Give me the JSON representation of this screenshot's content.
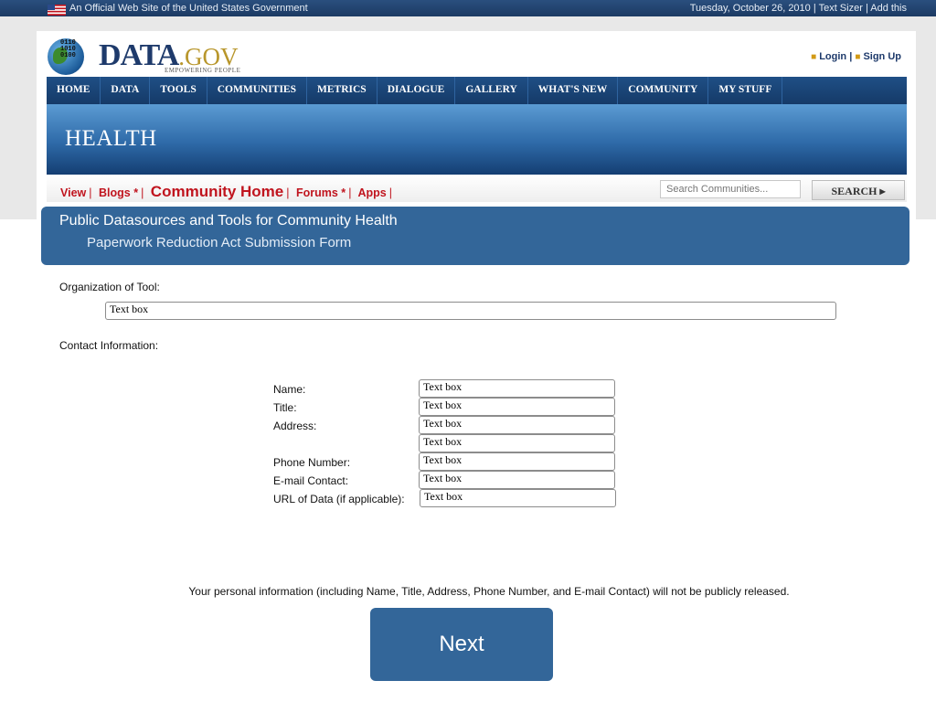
{
  "govbar": {
    "official_text": "An Official Web Site of the United States Government",
    "date": "Tuesday, October 26, 2010",
    "text_sizer": "Text Sizer",
    "add_this": "Add this",
    "sep": "|"
  },
  "logo": {
    "bits": "0110\n1010\n0100",
    "word": "DATA",
    "gov": ".GOV",
    "tagline": "EMPOWERING PEOPLE"
  },
  "auth": {
    "login": "Login",
    "sign_up": "Sign Up",
    "sep": "|"
  },
  "nav": [
    "HOME",
    "DATA",
    "TOOLS",
    "COMMUNITIES",
    "METRICS",
    "DIALOGUE",
    "GALLERY",
    "WHAT'S NEW",
    "COMMUNITY",
    "MY STUFF"
  ],
  "banner": {
    "title": "HEALTH"
  },
  "subnav": {
    "view": "View",
    "blogs": "Blogs *",
    "community_home": "Community Home",
    "forums": "Forums *",
    "apps": "Apps",
    "sep": "|",
    "search_placeholder": "Search Communities...",
    "search_button": "SEARCH"
  },
  "form_header": {
    "title": "Public Datasources and Tools for Community Health",
    "subtitle": "Paperwork Reduction Act Submission Form"
  },
  "form": {
    "organization_label": "Organization of Tool:",
    "organization_value": "Text box",
    "contact_label": "Contact Information:",
    "fields": {
      "name_label": "Name:",
      "name_value": "Text box",
      "title_label": "Title:",
      "title_value": "Text box",
      "address_label": "Address:",
      "address1_value": "Text box",
      "address2_value": "Text box",
      "phone_label": "Phone Number:",
      "phone_value": "Text box",
      "email_label": "E-mail Contact:",
      "email_value": "Text box",
      "url_label": "URL of Data (if applicable):",
      "url_value": "Text box"
    },
    "privacy_note": "Your  personal information (including Name, Title, Address, Phone Number, and E-mail Contact) will not be publicly released.",
    "next_label": "Next"
  },
  "colors": {
    "accent": "#336699",
    "nav": "#1f4f86",
    "link_red": "#c0141e"
  }
}
